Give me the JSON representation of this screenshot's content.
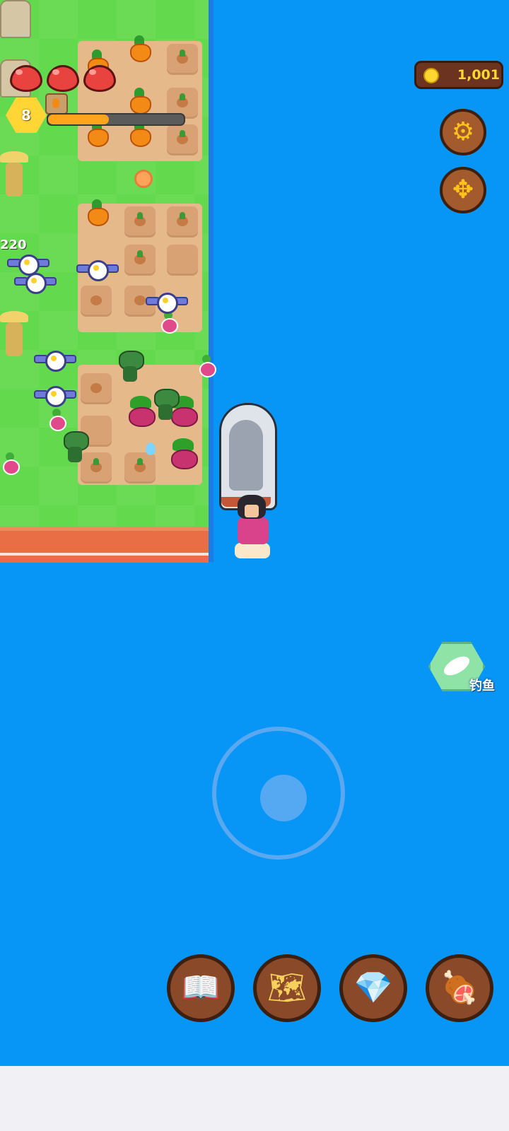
{
  "hud": {
    "hearts": 3,
    "level": "8",
    "xp_progress": 0.45,
    "coins": "1,001"
  },
  "buttons": {
    "settings_icon": "gear-icon",
    "move_icon": "move-arrows-icon"
  },
  "fishing": {
    "label": "钓鱼",
    "icon": "fish-icon"
  },
  "floating_text": {
    "value": "220"
  },
  "menu": [
    {
      "name": "book-button",
      "icon": "book-icon"
    },
    {
      "name": "map-button",
      "icon": "map-icon"
    },
    {
      "name": "gem-shop-button",
      "icon": "gem-icon"
    },
    {
      "name": "meat-button",
      "icon": "meat-icon"
    }
  ],
  "colors": {
    "water": "#0796f5",
    "grass": "#63d94d",
    "coin": "#ffd630",
    "xp": "#ffa51c"
  }
}
